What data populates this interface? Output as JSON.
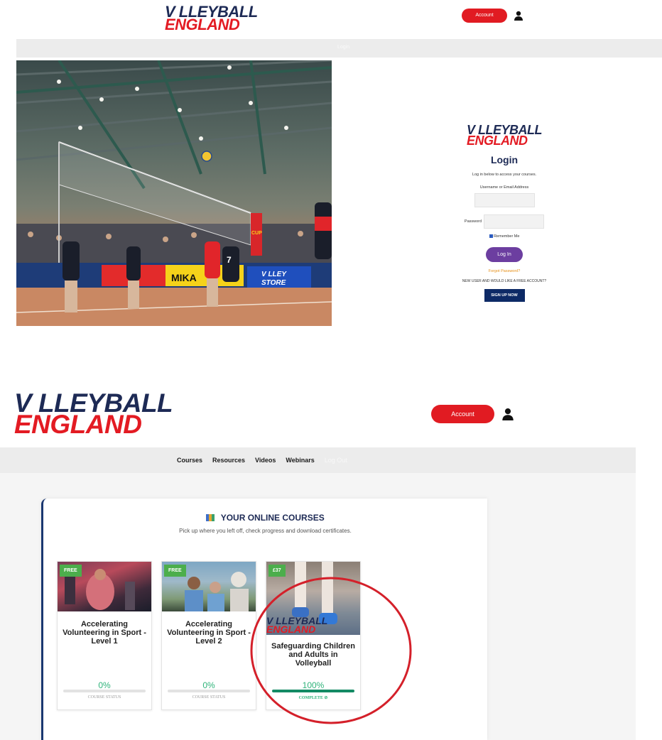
{
  "top": {
    "logo_line1": "V LLEYBALL",
    "logo_line2": "ENGLAND",
    "account_label": "Account",
    "nav_faint": "Login",
    "login": {
      "heading": "Login",
      "intro": "Log in below to access your courses.",
      "username_label": "Username or Email Address",
      "password_label": "Password",
      "remember_label": "Remember Me",
      "login_button": "Log In",
      "forgot_link": "Forgot Password?",
      "new_user_text": "NEW USER AND WOULD LIKE A FREE ACCOUNT?",
      "signup_button": "SIGN UP NOW"
    },
    "photo_signs": [
      "MIKA",
      "V LLEY",
      "STORE",
      "CUP",
      "7"
    ]
  },
  "bottom": {
    "logo_line1": "V LLEYBALL",
    "logo_line2": "ENGLAND",
    "account_label": "Account",
    "nav": [
      "Courses",
      "Resources",
      "Videos",
      "Webinars"
    ],
    "nav_faint": "Log Out",
    "courses": {
      "heading": "YOUR ONLINE COURSES",
      "subheading": "Pick up where you left off, check progress and download certificates.",
      "items": [
        {
          "tag": "FREE",
          "title": "Accelerating Volunteering in Sport - Level 1",
          "percent": "0%",
          "progress": 0,
          "status": "COURSE STATUS"
        },
        {
          "tag": "FREE",
          "title": "Accelerating Volunteering in Sport - Level 2",
          "percent": "0%",
          "progress": 0,
          "status": "COURSE STATUS"
        },
        {
          "tag": "£37",
          "title": "Safeguarding Children and Adults in Volleyball",
          "percent": "100%",
          "progress": 1,
          "status": "COMPLETE ⊘"
        }
      ]
    }
  },
  "colors": {
    "red": "#e11b22",
    "navy": "#1d2a55",
    "purple": "#6c3ea0",
    "green": "#2fb37a",
    "annotation": "#d4202a"
  }
}
